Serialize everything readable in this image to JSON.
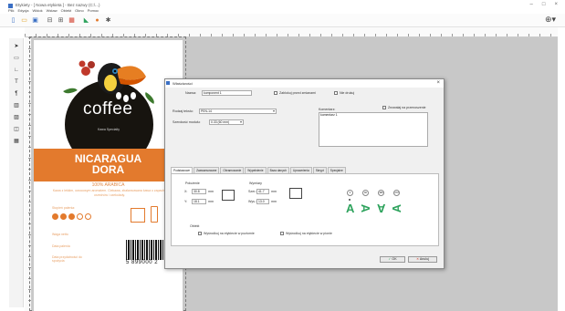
{
  "window": {
    "title": "Etykiety - [ Nowa etykieta ] - Bez nazwy (C:\\...)",
    "menu": [
      "Plik",
      "Edycja",
      "Widok",
      "Wstaw",
      "Obiekt",
      "Okno",
      "Pomoc"
    ],
    "controls": [
      "–",
      "□",
      "×"
    ],
    "zoom_icon": "zoom-icon"
  },
  "toolbar": {
    "icons": [
      "new-icon",
      "open-icon",
      "save-icon",
      "print-icon",
      "print-preview-icon",
      "database-icon",
      "color-icon",
      "settings-icon",
      "help-icon"
    ]
  },
  "left_tools": {
    "icons": [
      "pointer-icon",
      "rectangle-icon",
      "line-icon",
      "text-icon",
      "paragraph-icon",
      "barcode-icon",
      "picture-icon",
      "layers-icon",
      "table-icon"
    ]
  },
  "label": {
    "brand": "coffee",
    "brand_sub": "Kawa Specialty",
    "origin_line1": "NICARAGUA",
    "origin_line2": "DORA",
    "blend": "100% ARABICA",
    "description": "Kawa z lekkim, owocowym aromatem. Ciekawa, zbalansowana kawa o zapachu orzechów i czekolady.",
    "roast_label": "Stopień palenia:",
    "roast_level": 3,
    "roast_max": 5,
    "field1": "Waga netto",
    "field2": "Data palenia",
    "field3": "Data przydatności do spożycia",
    "barcode_number": "5 899000 2",
    "colors": {
      "accent": "#e37a2d",
      "dark": "#17140f"
    }
  },
  "dialog": {
    "title": "Właściwości",
    "close_label": "×",
    "name_label": "Nazwa:",
    "name_value": "komponent 1",
    "lock_label": "Zablokuj przed zmianami",
    "hidden_label": "Nie drukuj",
    "font_label": "Rodzaj tekstu:",
    "font_value": "PEN-14",
    "size_label": "Szerokość modułu:",
    "size_value": "0.33 (60 mm)",
    "comment_label": "Komentarz:",
    "comment_value": "komentarz 1",
    "multi_label": "Zezwalaj na przenoszenie",
    "tabs": [
      "Podstawowe",
      "Zaawansowane",
      "Obramowanie",
      "Wypełnienie",
      "Baza danych",
      "Uprawnienia",
      "Skrypt",
      "Specjalne"
    ],
    "position_title": "Położenie",
    "x_label": "X:",
    "x_value": "30.8",
    "y_label": "Y:",
    "y_value": "18.1",
    "unit": "mm",
    "size_title": "Wymiary",
    "w_label": "Szer.:",
    "w_value": "41.7",
    "h_label": "Wys.:",
    "h_value": "13.0",
    "rotation_options": [
      "0",
      "90",
      "180",
      "270"
    ],
    "selected_rotation": "0",
    "glyph": "A",
    "options_title": "Obiekt",
    "option1": "Wyśrodkuj na etykiecie w poziomie",
    "option2": "Wyśrodkuj na etykiecie w pionie",
    "ok_label": "OK",
    "cancel_label": "Anuluj",
    "ok_icon": "check-icon",
    "cancel_icon": "cross-icon"
  }
}
